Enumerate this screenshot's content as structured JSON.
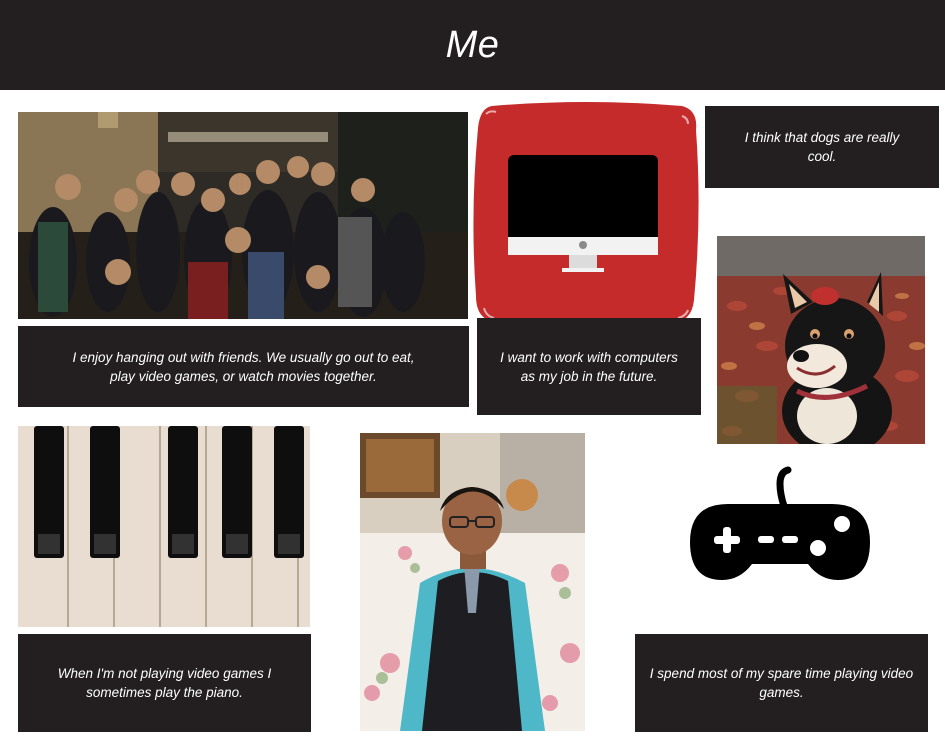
{
  "header": {
    "title": "Me"
  },
  "captions": {
    "friends": "I enjoy hanging out with friends. We usually go out to eat, play video games, or watch movies together.",
    "computers": "I want to work with computers as my job in the future.",
    "dogs": "I think that dogs are really cool.",
    "piano": "When I'm not playing video games I sometimes play the piano.",
    "games": "I spend most of my spare time playing video games."
  },
  "colors": {
    "dark_panel": "#231f20",
    "computer_tile": "#c62b2b",
    "white": "#ffffff"
  },
  "icons": {
    "computer": "desktop-monitor-icon",
    "controller": "gamepad-icon"
  }
}
